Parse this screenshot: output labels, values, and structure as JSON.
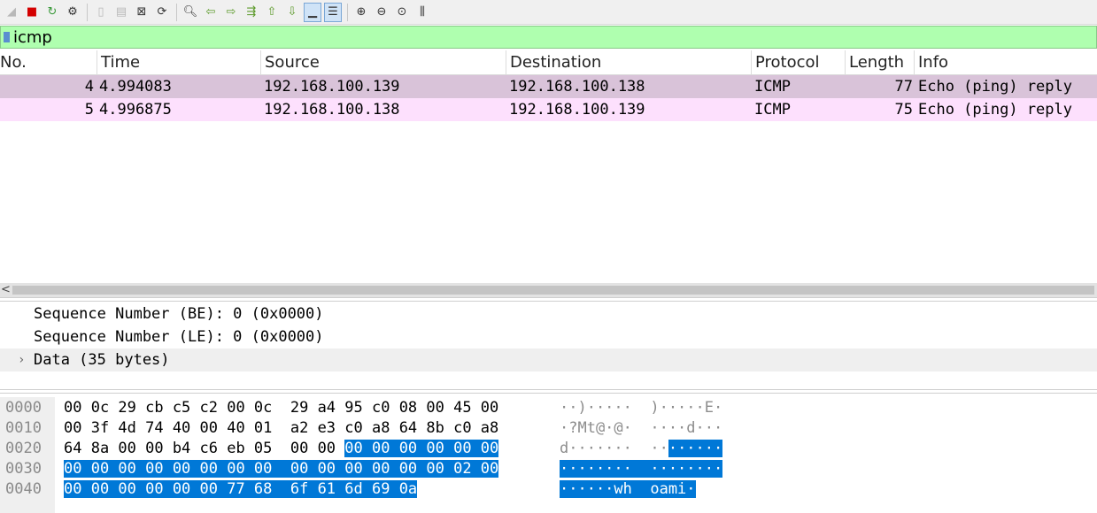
{
  "toolbar": {
    "icons": [
      "shark-fin-start-icon",
      "stop-capture-icon",
      "restart-capture-icon",
      "capture-options-icon",
      "open-file-icon",
      "save-file-icon",
      "close-file-icon",
      "reload-file-icon",
      "find-packet-icon",
      "go-back-icon",
      "go-forward-icon",
      "go-to-packet-icon",
      "first-packet-icon",
      "last-packet-icon",
      "auto-scroll-icon",
      "colorize-icon",
      "zoom-in-icon",
      "zoom-out-icon",
      "normal-size-icon",
      "resize-columns-icon"
    ]
  },
  "filter": {
    "value": "icmp"
  },
  "packet_list": {
    "columns": [
      "No.",
      "Time",
      "Source",
      "Destination",
      "Protocol",
      "Length",
      "Info"
    ],
    "rows": [
      {
        "no": "4",
        "time": "4.994083",
        "source": "192.168.100.139",
        "destination": "192.168.100.138",
        "protocol": "ICMP",
        "length": "77",
        "info": "Echo (ping) reply",
        "bg": "#d9c3d9"
      },
      {
        "no": "5",
        "time": "4.996875",
        "source": "192.168.100.138",
        "destination": "192.168.100.139",
        "protocol": "ICMP",
        "length": "75",
        "info": "Echo (ping) reply",
        "bg": "#fde0fd"
      }
    ]
  },
  "scroll": {
    "left_arrow": "<"
  },
  "details": {
    "rows": [
      {
        "text": "Sequence Number (BE): 0 (0x0000)",
        "expander": ""
      },
      {
        "text": "Sequence Number (LE): 0 (0x0000)",
        "expander": ""
      },
      {
        "text": "Data (35 bytes)",
        "expander": "›"
      }
    ]
  },
  "bytes": {
    "rows": [
      {
        "offset": "0000",
        "hex_plain": "00 0c 29 cb c5 c2 00 0c  29 a4 95 c0 08 00 45 00",
        "hex_sel": "",
        "ascii_plain": "··)·····  )·····E·",
        "ascii_sel": ""
      },
      {
        "offset": "0010",
        "hex_plain": "00 3f 4d 74 40 00 40 01  a2 e3 c0 a8 64 8b c0 a8",
        "hex_sel": "",
        "ascii_plain": "·?Mt@·@·  ····d···",
        "ascii_sel": ""
      },
      {
        "offset": "0020",
        "hex_plain": "64 8a 00 00 b4 c6 eb 05  00 00 ",
        "hex_sel": "00 00 00 00 00 00",
        "ascii_plain": "d·······  ··",
        "ascii_sel": "······"
      },
      {
        "offset": "0030",
        "hex_plain": "",
        "hex_sel": "00 00 00 00 00 00 00 00  00 00 00 00 00 00 02 00",
        "ascii_plain": "",
        "ascii_sel": "········  ········"
      },
      {
        "offset": "0040",
        "hex_plain": "",
        "hex_sel": "00 00 00 00 00 00 77 68  6f 61 6d 69 0a",
        "ascii_plain": "",
        "ascii_sel": "······wh  oami·"
      }
    ]
  }
}
